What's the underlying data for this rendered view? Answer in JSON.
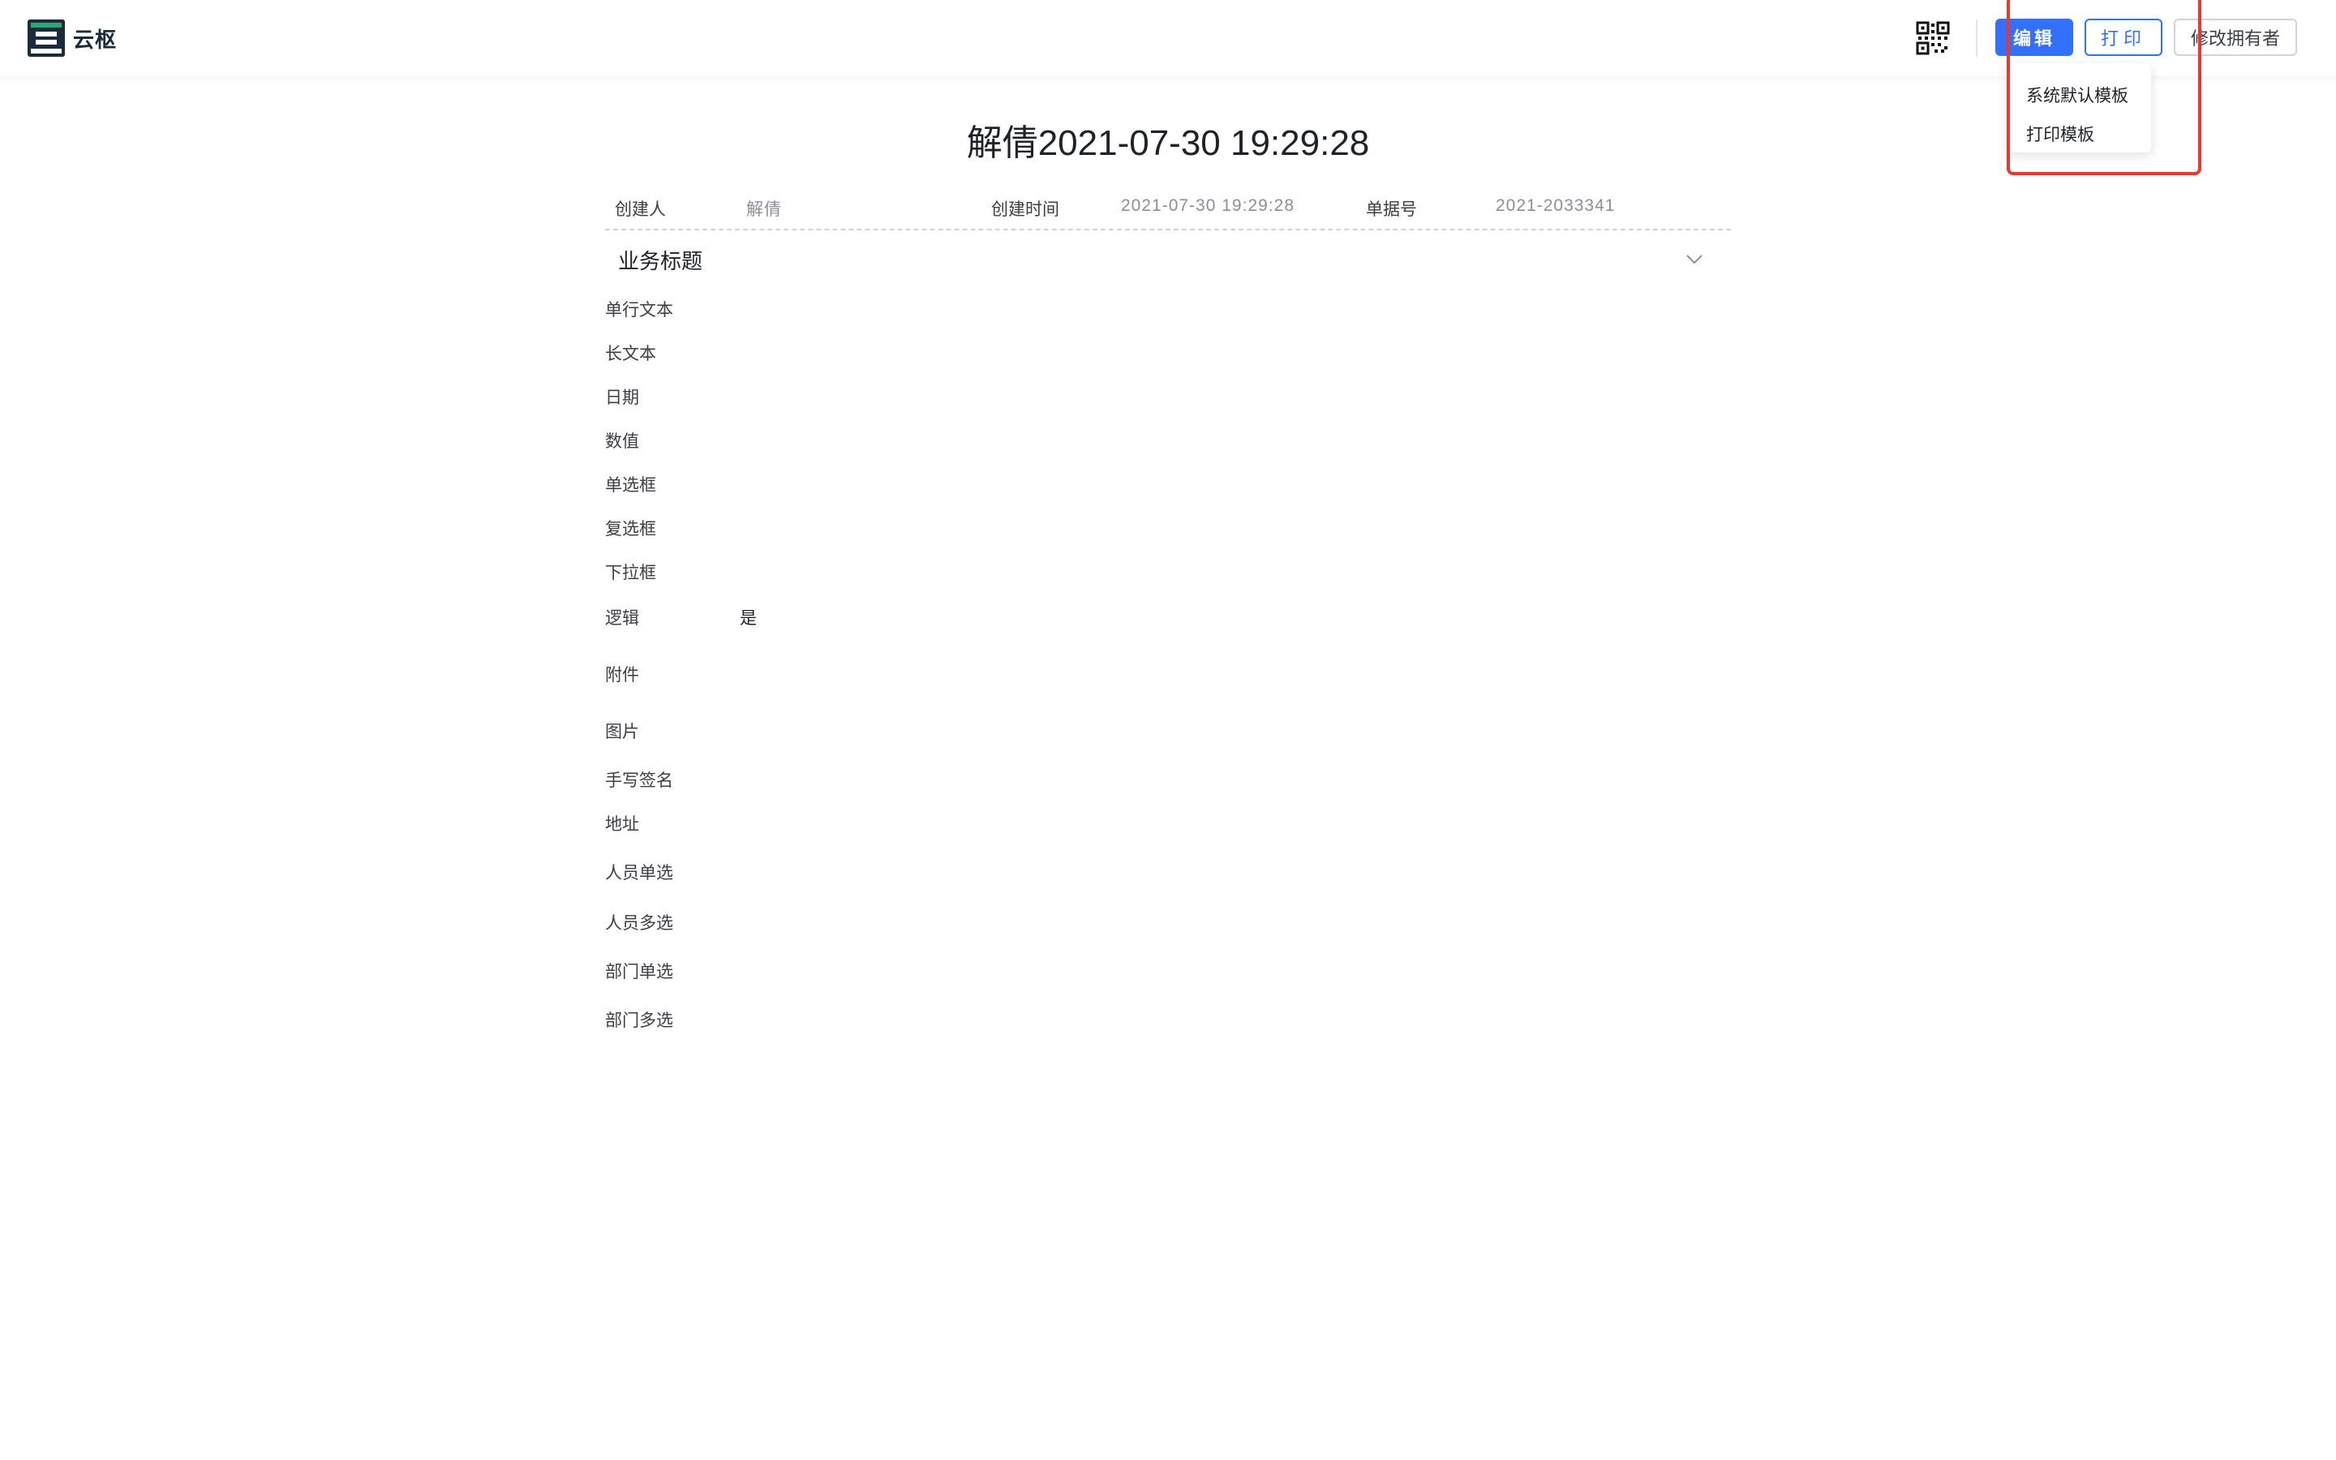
{
  "header": {
    "logo_text": "云枢",
    "edit_label": "编辑",
    "print_label": "打印",
    "owner_label": "修改拥有者"
  },
  "print_menu": {
    "items": [
      "系统默认模板",
      "打印模板"
    ]
  },
  "form": {
    "title": "解倩2021-07-30 19:29:28",
    "meta": [
      {
        "label": "创建人",
        "value": "解倩"
      },
      {
        "label": "创建时间",
        "value": "2021-07-30 19:29:28"
      },
      {
        "label": "单据号",
        "value": "2021-2033341"
      }
    ],
    "section_title": "业务标题",
    "fields": [
      {
        "label": "单行文本",
        "value": ""
      },
      {
        "label": "长文本",
        "value": ""
      },
      {
        "label": "日期",
        "value": ""
      },
      {
        "label": "数值",
        "value": ""
      },
      {
        "label": "单选框",
        "value": ""
      },
      {
        "label": "复选框",
        "value": ""
      },
      {
        "label": "下拉框",
        "value": ""
      },
      {
        "label": "逻辑",
        "value": "是"
      },
      {
        "label": "附件",
        "value": ""
      },
      {
        "label": "图片",
        "value": ""
      },
      {
        "label": "手写签名",
        "value": ""
      },
      {
        "label": "地址",
        "value": ""
      },
      {
        "label": "人员单选",
        "value": ""
      },
      {
        "label": "人员多选",
        "value": ""
      },
      {
        "label": "部门单选",
        "value": ""
      },
      {
        "label": "部门多选",
        "value": ""
      }
    ]
  },
  "icons": {
    "logo": "logo-icon",
    "qr": "qr-code-icon",
    "collapse": "chevron-down-icon"
  },
  "colors": {
    "primary": "#3370ff",
    "highlight": "#e53a2f",
    "logo_green": "#2aa876",
    "logo_dark": "#1a2b3c"
  }
}
